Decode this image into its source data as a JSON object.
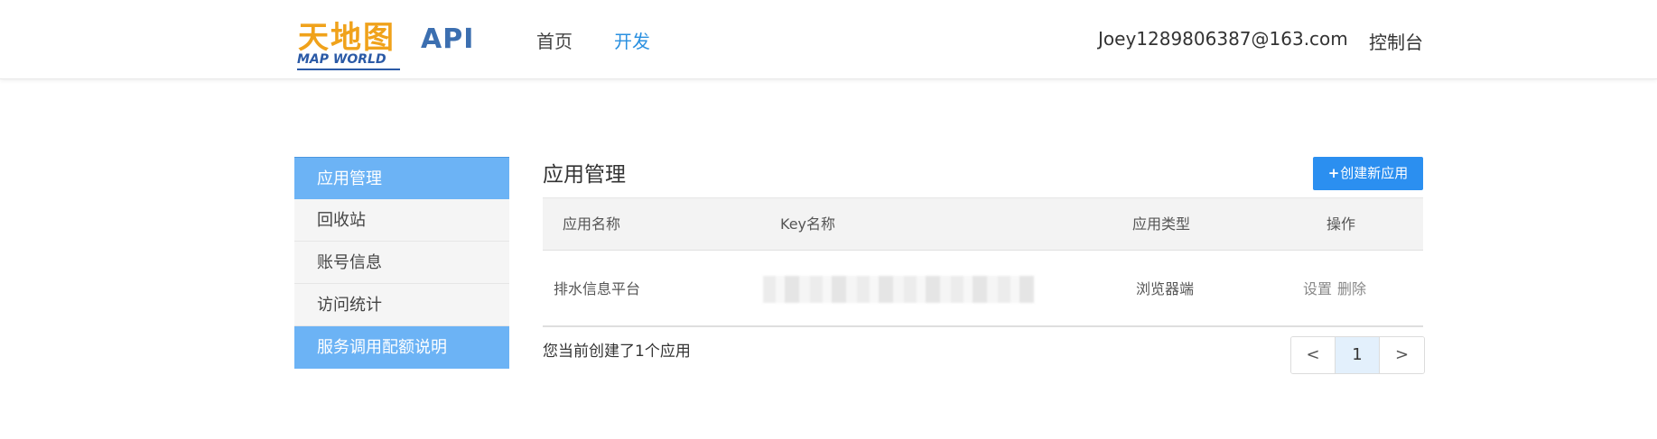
{
  "header": {
    "logo_cn": "天地图",
    "logo_en": "MAP WORLD",
    "logo_api": "API",
    "nav": [
      {
        "label": "首页",
        "active": false
      },
      {
        "label": "开发",
        "active": true
      }
    ],
    "user_email": "Joey1289806387@163.com",
    "console_label": "控制台"
  },
  "sidebar": {
    "items": [
      {
        "label": "应用管理"
      },
      {
        "label": "回收站"
      },
      {
        "label": "账号信息"
      },
      {
        "label": "访问统计"
      },
      {
        "label": "服务调用配额说明"
      }
    ]
  },
  "main": {
    "title": "应用管理",
    "create_button": {
      "icon": "+",
      "label": "创建新应用"
    },
    "table": {
      "columns": [
        "应用名称",
        "Key名称",
        "应用类型",
        "操作"
      ],
      "rows": [
        {
          "name": "排水信息平台",
          "key": "",
          "type": "浏览器端",
          "actions": [
            "设置",
            "删除"
          ]
        }
      ]
    },
    "count_text": "您当前创建了1个应用",
    "pagination": {
      "prev": "<",
      "current": "1",
      "next": ">"
    }
  },
  "colors": {
    "accent": "#2b8ff0",
    "sidebar_active": "#6cb3f5",
    "logo_orange": "#f0a21b",
    "logo_blue": "#2b5aa6"
  }
}
